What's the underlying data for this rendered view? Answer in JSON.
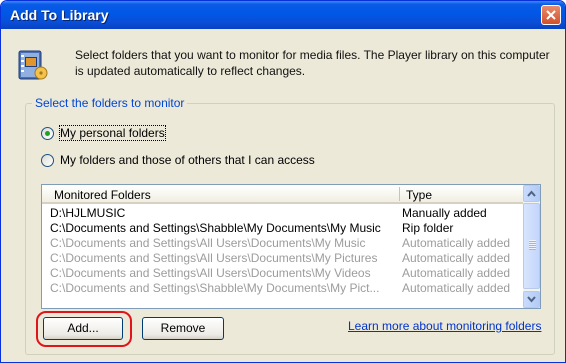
{
  "window": {
    "title": "Add To Library"
  },
  "intro_text": "Select folders that you want to monitor for media files. The Player library on this computer is updated automatically to reflect changes.",
  "group": {
    "legend": "Select the folders to monitor",
    "options": [
      {
        "label": "My personal folders",
        "selected": true
      },
      {
        "label": "My folders and those of others that I can access",
        "selected": false
      }
    ]
  },
  "list": {
    "columns": [
      "Monitored Folders",
      "Type"
    ],
    "rows": [
      {
        "folder": "D:\\HJLMUSIC",
        "type": "Manually added",
        "enabled": true
      },
      {
        "folder": "C:\\Documents and Settings\\Shabble\\My Documents\\My Music",
        "type": "Rip folder",
        "enabled": true
      },
      {
        "folder": "C:\\Documents and Settings\\All Users\\Documents\\My Music",
        "type": "Automatically added",
        "enabled": false
      },
      {
        "folder": "C:\\Documents and Settings\\All Users\\Documents\\My Pictures",
        "type": "Automatically added",
        "enabled": false
      },
      {
        "folder": "C:\\Documents and Settings\\All Users\\Documents\\My Videos",
        "type": "Automatically added",
        "enabled": false
      },
      {
        "folder": "C:\\Documents and Settings\\Shabble\\My Documents\\My Pict...",
        "type": "Automatically added",
        "enabled": false
      }
    ]
  },
  "buttons": {
    "add": "Add...",
    "remove": "Remove"
  },
  "learn_more_link": "Learn more about monitoring folders",
  "colors": {
    "title_bar": "#0058e6",
    "highlight_ring": "#e0141a",
    "legend_text": "#0046d5",
    "link": "#0033cc"
  }
}
